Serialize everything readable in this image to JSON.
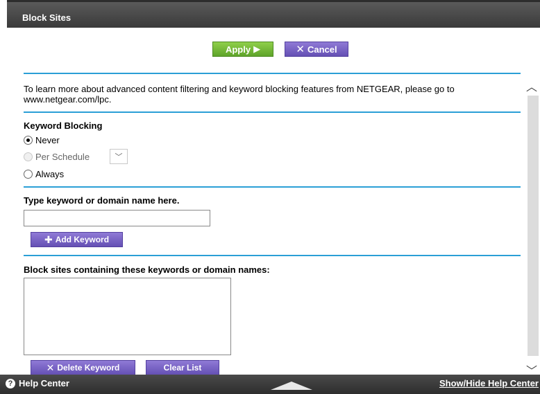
{
  "header": {
    "title": "Block Sites"
  },
  "toolbar": {
    "apply_label": "Apply",
    "apply_icon": "play-arrow-icon",
    "cancel_label": "Cancel",
    "cancel_icon": "x-icon"
  },
  "info": {
    "text": "To learn more about advanced content filtering and keyword blocking features from NETGEAR, please go to www.netgear.com/lpc."
  },
  "keyword_blocking": {
    "heading": "Keyword Blocking",
    "options": [
      {
        "label": "Never",
        "selected": true,
        "enabled": true
      },
      {
        "label": "Per Schedule",
        "selected": false,
        "enabled": false
      },
      {
        "label": "Always",
        "selected": false,
        "enabled": true
      }
    ],
    "schedule_select_value": ""
  },
  "keyword_entry": {
    "heading": "Type keyword or domain name here.",
    "input_value": "",
    "add_button_label": "Add Keyword"
  },
  "blocked_list": {
    "heading": "Block sites containing these keywords or domain names:",
    "items": [],
    "delete_button_label": "Delete Keyword",
    "clear_button_label": "Clear List"
  },
  "footer": {
    "help_label": "Help Center",
    "toggle_label": "Show/Hide Help Center"
  },
  "colors": {
    "accent_rule": "#2a9fd6",
    "apply_green": "#6db432",
    "purple": "#7560c4",
    "titlebar": "#444444"
  }
}
